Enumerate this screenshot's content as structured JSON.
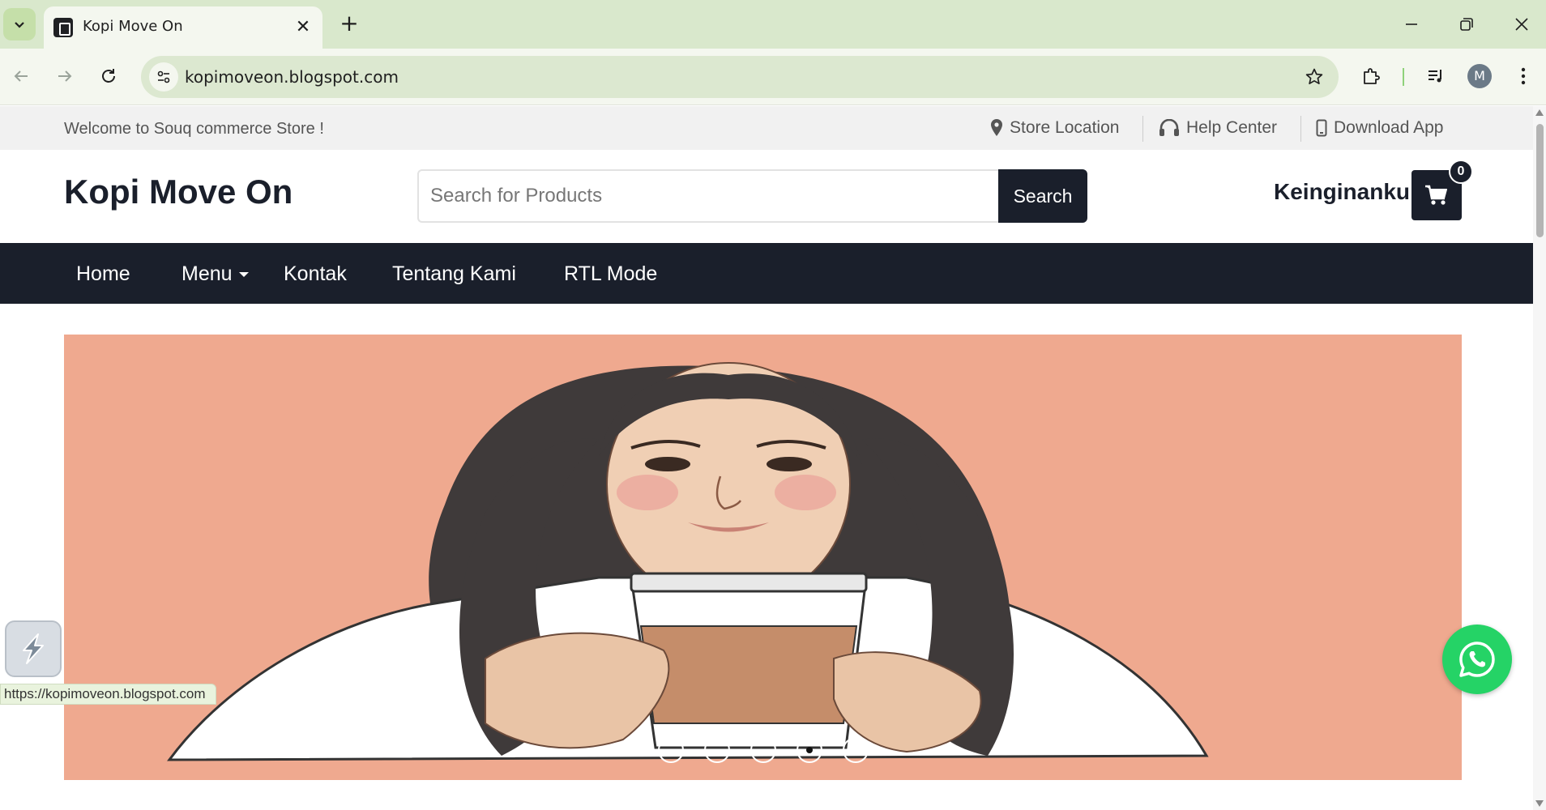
{
  "browser": {
    "tab_title": "Kopi Move On",
    "url": "kopimoveon.blogspot.com",
    "profile_initial": "M",
    "status_url": "https://kopimoveon.blogspot.com",
    "theme_color": "#d9e8cc"
  },
  "topbar": {
    "welcome": "Welcome to Souq commerce Store !",
    "links": [
      {
        "label": "Store Location",
        "icon": "map-pin-icon"
      },
      {
        "label": "Help Center",
        "icon": "headphones-icon"
      },
      {
        "label": "Download App",
        "icon": "mobile-phone-icon"
      }
    ]
  },
  "header": {
    "brand": "Kopi Move On",
    "search_placeholder": "Search for Products",
    "search_button": "Search",
    "wishlist_label": "Keinginanku",
    "cart_count": "0",
    "accent_color": "#1a1f2b"
  },
  "nav": {
    "items": [
      {
        "label": "Home"
      },
      {
        "label": "Menu",
        "has_dropdown": true
      },
      {
        "label": "Kontak"
      },
      {
        "label": "Tentang Kami"
      },
      {
        "label": "RTL Mode"
      }
    ]
  },
  "slider": {
    "background_color": "#efa98f",
    "dot_count": 5,
    "active_dot_index": 3
  },
  "floating": {
    "whatsapp_icon": "whatsapp-icon",
    "whatsapp_color": "#25d366",
    "extension_icon": "lightning-extension-icon"
  }
}
